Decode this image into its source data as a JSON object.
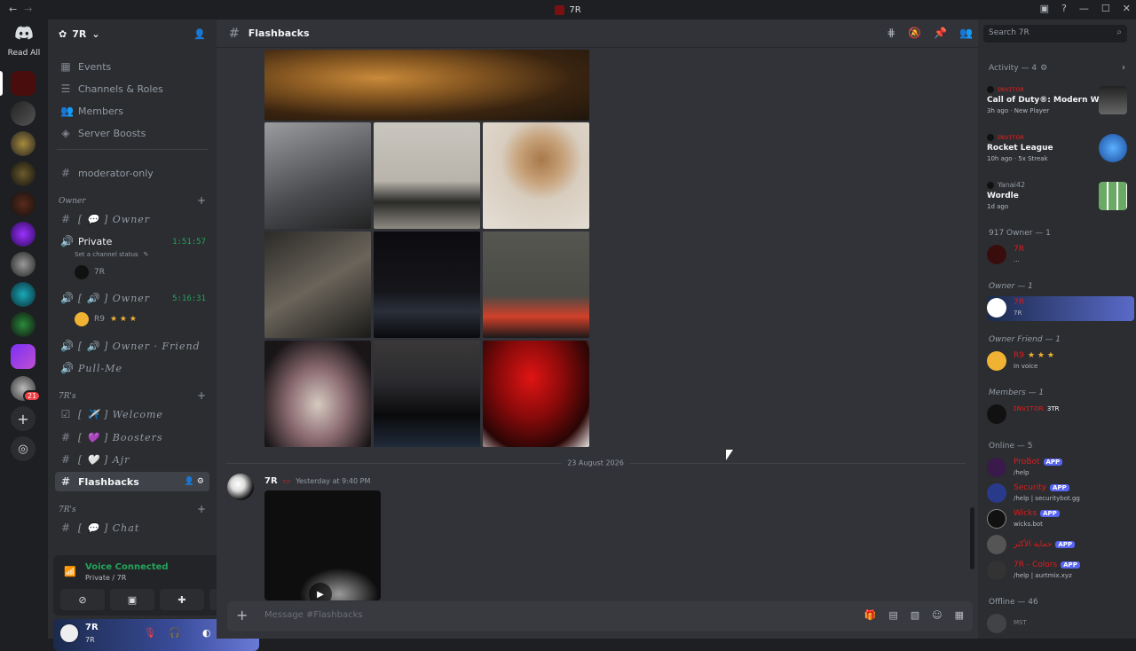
{
  "titlebar": {
    "title": "7R",
    "back": "←",
    "forward": "→"
  },
  "guilds": {
    "read_all": "Read All",
    "badge": "21"
  },
  "server": {
    "name": "7R"
  },
  "nav": {
    "events": "Events",
    "channels_roles": "Channels & Roles",
    "members": "Members",
    "boosts": "Server Boosts",
    "moderator": "moderator-only"
  },
  "cats": {
    "owner": "Owner",
    "r7": "7R's",
    "r7b": "7R's"
  },
  "channels": {
    "owner_text": "[ 💬 ] Owner",
    "private": "Private",
    "private_time": "1:51:57",
    "private_status": "Set a channel status",
    "private_user": "7R",
    "owner_voice": "[ 🔊 ] Owner",
    "owner_voice_time": "5:16:31",
    "owner_voice_user": "R9",
    "owner_friend": "[ 🔊 ] Owner · Friend",
    "pull_me": "Pull-Me",
    "welcome": "[ ✈️ ] Welcome",
    "boosters": "[ 💜 ] Boosters",
    "ajr": "[ 🤍 ] Ajr",
    "flashbacks": "Flashbacks",
    "chat": "[ 💬 ] Chat"
  },
  "voice": {
    "status": "Voice Connected",
    "location": "Private / 7R"
  },
  "user": {
    "name": "7R",
    "status": "7R"
  },
  "main": {
    "channel": "Flashbacks",
    "date": "23 August 2026",
    "msg_author": "7R",
    "msg_time": "Yesterday at 9:40 PM",
    "placeholder": "Message #Flashbacks"
  },
  "members": {
    "search": "Search 7R",
    "activity_head": "Activity — 4",
    "activities": [
      {
        "user": "ɪɴᴠɪᴛᴏʀ",
        "game": "Call of Duty®: Modern Warf...",
        "meta": "3h ago · New Player"
      },
      {
        "user": "ɪɴᴠɪᴛᴏʀ",
        "game": "Rocket League",
        "meta": "10h ago · 5x Streak"
      },
      {
        "user": "Yanai42",
        "game": "Wordle",
        "meta": "1d ago"
      }
    ],
    "role_917": "917 Owner — 1",
    "m917": "7R",
    "m917s": "...",
    "role_owner": "Owner — 1",
    "m_owner": "7R",
    "m_owner_s": "7R",
    "role_friend": "Owner Friend — 1",
    "m_friend": "R9",
    "m_friend_s": "In voice",
    "role_members": "Members — 1",
    "m_members": "ɪɴᴠɪᴛᴏʀ",
    "m_members_tag": "3TR",
    "online_head": "Online — 5",
    "online": [
      {
        "name": "ProBot",
        "sub": "/help"
      },
      {
        "name": "Security",
        "sub": "/help | securitybot.gg"
      },
      {
        "name": "Wicks",
        "sub": "wicks.bot"
      },
      {
        "name": "حماية الأكثر",
        "sub": ""
      },
      {
        "name": "7R - Colors",
        "sub": "/help | aurtmix.xyz"
      }
    ],
    "app_label": "APP",
    "offline_head": "Offline — 46",
    "offline_tag": "MST"
  },
  "colors": {
    "accent": "#5865f2",
    "online": "#23a55a",
    "red": "#e01b1b"
  }
}
